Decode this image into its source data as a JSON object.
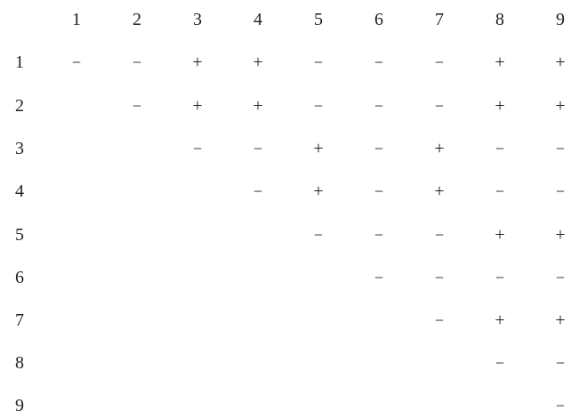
{
  "table": {
    "column_headers": [
      "1",
      "2",
      "3",
      "4",
      "5",
      "6",
      "7",
      "8",
      "9"
    ],
    "row_headers": [
      "1",
      "2",
      "3",
      "4",
      "5",
      "6",
      "7",
      "8",
      "9"
    ],
    "rows": [
      [
        "−",
        "−",
        "+",
        "+",
        "−",
        "−",
        "−",
        "+",
        "+"
      ],
      [
        "",
        "−",
        "+",
        "+",
        "−",
        "−",
        "−",
        "+",
        "+"
      ],
      [
        "",
        "",
        "−",
        "−",
        "+",
        "−",
        "+",
        "−",
        "−"
      ],
      [
        "",
        "",
        "",
        "−",
        "+",
        "−",
        "+",
        "−",
        "−"
      ],
      [
        "",
        "",
        "",
        "",
        "−",
        "−",
        "−",
        "+",
        "+"
      ],
      [
        "",
        "",
        "",
        "",
        "",
        "−",
        "−",
        "−",
        "−"
      ],
      [
        "",
        "",
        "",
        "",
        "",
        "",
        "−",
        "+",
        "+"
      ],
      [
        "",
        "",
        "",
        "",
        "",
        "",
        "",
        "−",
        "−"
      ],
      [
        "",
        "",
        "",
        "",
        "",
        "",
        "",
        "",
        "−"
      ]
    ]
  }
}
